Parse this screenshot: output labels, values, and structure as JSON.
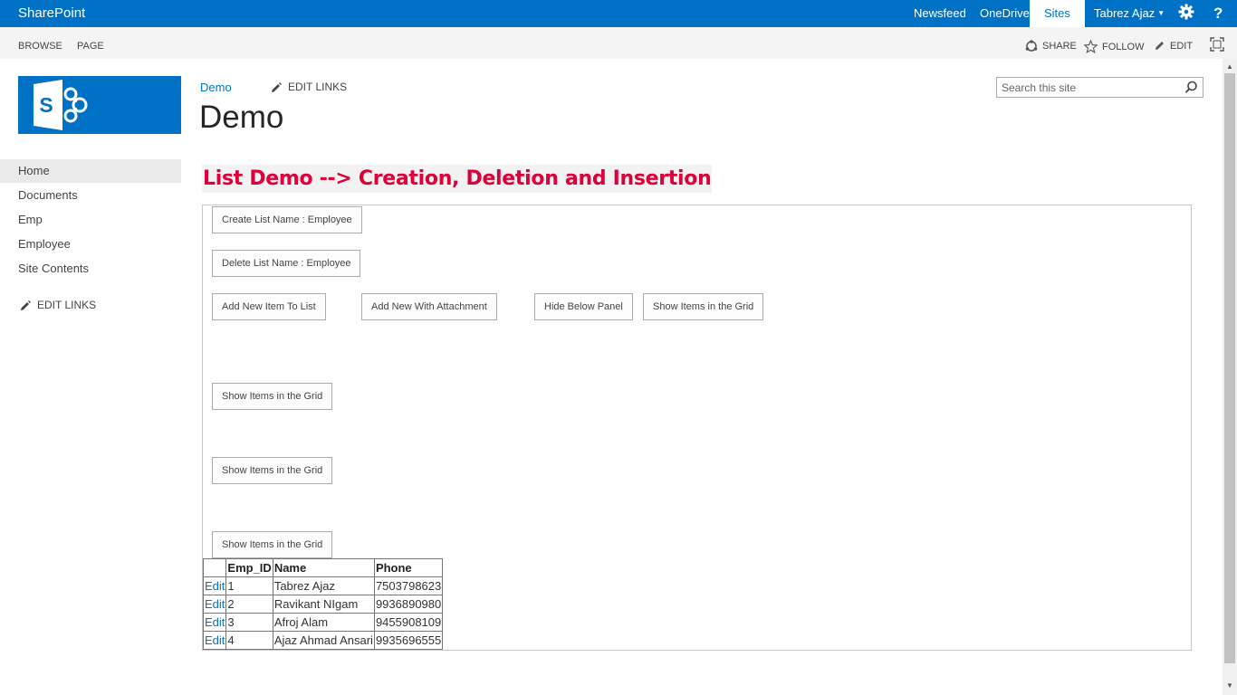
{
  "suitebar": {
    "brand": "SharePoint",
    "links": [
      "Newsfeed",
      "OneDrive",
      "Sites"
    ],
    "active_link": "Sites",
    "user": "Tabrez Ajaz",
    "icons": [
      "gear-icon",
      "help-icon"
    ],
    "help_glyph": "?",
    "bar_color": "#0072c6"
  },
  "ribbon": {
    "tabs": [
      "BROWSE",
      "PAGE"
    ],
    "actions": {
      "share": "SHARE",
      "follow": "FOLLOW",
      "edit": "EDIT"
    }
  },
  "breadcrumb": "Demo",
  "edit_links": "EDIT LINKS",
  "page_title": "Demo",
  "search": {
    "placeholder": "Search this site"
  },
  "quick_launch": {
    "items": [
      "Home",
      "Documents",
      "Emp",
      "Employee",
      "Site Contents"
    ],
    "selected": "Home",
    "edit_links": "EDIT LINKS"
  },
  "heading": "List Demo --> Creation, Deletion and Insertion",
  "heading_color": "#dd0039",
  "buttons": {
    "create_list": "Create List Name : Employee",
    "delete_list": "Delete List Name : Employee",
    "add_item": "Add New Item To List",
    "add_with_attachment": "Add New With Attachment",
    "hide_panel": "Hide Below Panel",
    "show_items_1": "Show Items in the Grid",
    "show_items_2": "Show Items in the Grid",
    "show_items_3": "Show Items in the Grid",
    "show_items_4": "Show Items in the Grid"
  },
  "grid": {
    "headers": [
      "",
      "Emp_ID",
      "Name",
      "Phone"
    ],
    "edit_label": "Edit",
    "rows": [
      {
        "id": "1",
        "name": "Tabrez Ajaz",
        "phone": "7503798623"
      },
      {
        "id": "2",
        "name": "Ravikant NIgam",
        "phone": "9936890980"
      },
      {
        "id": "3",
        "name": "Afroj Alam",
        "phone": "9455908109"
      },
      {
        "id": "4",
        "name": "Ajaz Ahmad Ansari",
        "phone": "9935696555"
      }
    ]
  }
}
